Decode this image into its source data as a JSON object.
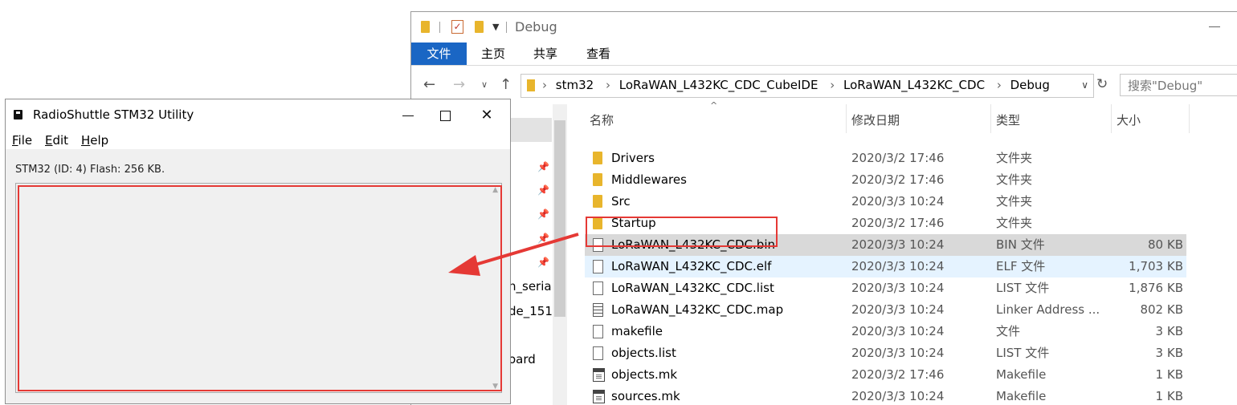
{
  "explorer": {
    "qat_title": "Debug",
    "tabs": [
      "文件",
      "主页",
      "共享",
      "查看"
    ],
    "address": {
      "crumbs": [
        "stm32",
        "LoRaWAN_L432KC_CDC_CubeIDE",
        "LoRaWAN_L432KC_CDC",
        "Debug"
      ]
    },
    "search_placeholder": "搜索\"Debug\"",
    "nav_items": [
      "n_serial",
      "de_151",
      "oard"
    ],
    "columns": {
      "name": "名称",
      "date": "修改日期",
      "type": "类型",
      "size": "大小"
    },
    "files": [
      {
        "name": "Drivers",
        "date": "2020/3/2 17:46",
        "type": "文件夹",
        "size": "",
        "icon": "folder"
      },
      {
        "name": "Middlewares",
        "date": "2020/3/2 17:46",
        "type": "文件夹",
        "size": "",
        "icon": "folder"
      },
      {
        "name": "Src",
        "date": "2020/3/3 10:24",
        "type": "文件夹",
        "size": "",
        "icon": "folder"
      },
      {
        "name": "Startup",
        "date": "2020/3/2 17:46",
        "type": "文件夹",
        "size": "",
        "icon": "folder"
      },
      {
        "name": "LoRaWAN_L432KC_CDC.bin",
        "date": "2020/3/3 10:24",
        "type": "BIN 文件",
        "size": "80 KB",
        "icon": "file"
      },
      {
        "name": "LoRaWAN_L432KC_CDC.elf",
        "date": "2020/3/3 10:24",
        "type": "ELF 文件",
        "size": "1,703 KB",
        "icon": "file"
      },
      {
        "name": "LoRaWAN_L432KC_CDC.list",
        "date": "2020/3/3 10:24",
        "type": "LIST 文件",
        "size": "1,876 KB",
        "icon": "file"
      },
      {
        "name": "LoRaWAN_L432KC_CDC.map",
        "date": "2020/3/3 10:24",
        "type": "Linker Address ...",
        "size": "802 KB",
        "icon": "text"
      },
      {
        "name": "makefile",
        "date": "2020/3/3 10:24",
        "type": "文件",
        "size": "3 KB",
        "icon": "file"
      },
      {
        "name": "objects.list",
        "date": "2020/3/3 10:24",
        "type": "LIST 文件",
        "size": "3 KB",
        "icon": "file"
      },
      {
        "name": "objects.mk",
        "date": "2020/3/2 17:46",
        "type": "Makefile",
        "size": "1 KB",
        "icon": "makefile"
      },
      {
        "name": "sources.mk",
        "date": "2020/3/3 10:24",
        "type": "Makefile",
        "size": "1 KB",
        "icon": "makefile"
      }
    ],
    "selected_file": "LoRaWAN_L432KC_CDC.bin",
    "hovered_file": "LoRaWAN_L432KC_CDC.elf"
  },
  "utility": {
    "title": "RadioShuttle STM32 Utility",
    "menu": [
      "File",
      "Edit",
      "Help"
    ],
    "status": "STM32 (ID: 4) Flash: 256 KB."
  },
  "colors": {
    "accent": "#1a66c4",
    "annotation": "#e53935",
    "folder": "#e8b52c"
  }
}
